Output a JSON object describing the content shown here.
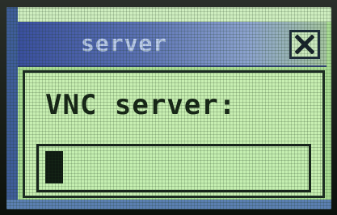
{
  "window": {
    "title": "server",
    "close_icon": "close-icon"
  },
  "prompt": {
    "label": "VNC server:",
    "input_value": ""
  },
  "colors": {
    "lcd_background": "#a9dc93",
    "titlebar": "#3a4fa0",
    "dialog_background": "#c8efb2",
    "text": "#162416"
  }
}
